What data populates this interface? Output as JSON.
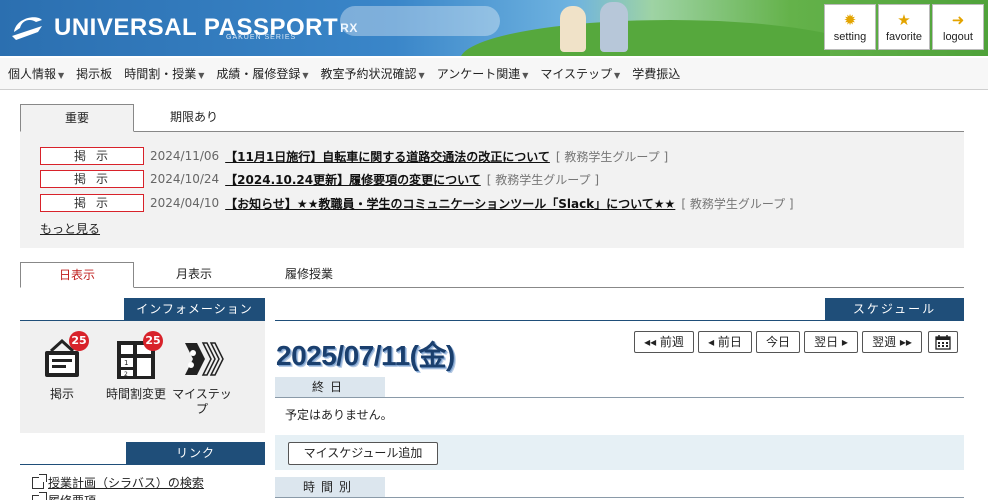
{
  "header": {
    "brand": "UNIVERSAL PASSPORT",
    "brand_suffix": "RX",
    "brand_sub": "GAKUEN SERIES",
    "buttons": [
      {
        "label": "setting",
        "icon": "gear-icon"
      },
      {
        "label": "favorite",
        "icon": "star-icon"
      },
      {
        "label": "logout",
        "icon": "runner-icon"
      }
    ]
  },
  "nav": {
    "items": [
      {
        "label": "個人情報",
        "dropdown": true
      },
      {
        "label": "掲示板",
        "dropdown": false
      },
      {
        "label": "時間割・授業",
        "dropdown": true
      },
      {
        "label": "成績・履修登録",
        "dropdown": true
      },
      {
        "label": "教室予約状況確認",
        "dropdown": true
      },
      {
        "label": "アンケート関連",
        "dropdown": true
      },
      {
        "label": "マイステップ",
        "dropdown": true
      },
      {
        "label": "学費振込",
        "dropdown": false
      }
    ]
  },
  "notice_tabs": [
    "重要",
    "期限あり"
  ],
  "notices": [
    {
      "badge": "掲示",
      "date": "2024/11/06",
      "title": "【11月1日施行】自転車に関する道路交通法の改正について",
      "group": "[ 教務学生グループ ]"
    },
    {
      "badge": "掲示",
      "date": "2024/10/24",
      "title": "【2024.10.24更新】履修要項の変更について",
      "group": "[ 教務学生グループ ]"
    },
    {
      "badge": "掲示",
      "date": "2024/04/10",
      "title": "【お知らせ】★★教職員・学生のコミュニケーションツール「Slack」について★★",
      "group": "[ 教務学生グループ ]"
    }
  ],
  "more_link": "もっと見る",
  "view_tabs": [
    "日表示",
    "月表示",
    "履修授業"
  ],
  "info": {
    "heading": "インフォメーション",
    "items": [
      {
        "label": "掲示",
        "count": "25",
        "icon": "board-icon"
      },
      {
        "label": "時間割変更",
        "count": "25",
        "icon": "timetable-icon"
      },
      {
        "label": "マイステップ",
        "count": "",
        "icon": "mystep-icon"
      }
    ]
  },
  "links": {
    "heading": "リンク",
    "items": [
      {
        "label": "授業計画（シラバス）の検索"
      },
      {
        "label": "履修要項"
      }
    ]
  },
  "schedule": {
    "heading": "スケジュール",
    "date": "2025/07/11(金)",
    "controls": [
      "◂◂ 前週",
      "◂ 前日",
      "今日",
      "翌日 ▸",
      "翌週 ▸▸"
    ],
    "allday_label": "終日",
    "no_plan": "予定はありません。",
    "add_button": "マイスケジュール追加",
    "by_time_label": "時間別"
  }
}
